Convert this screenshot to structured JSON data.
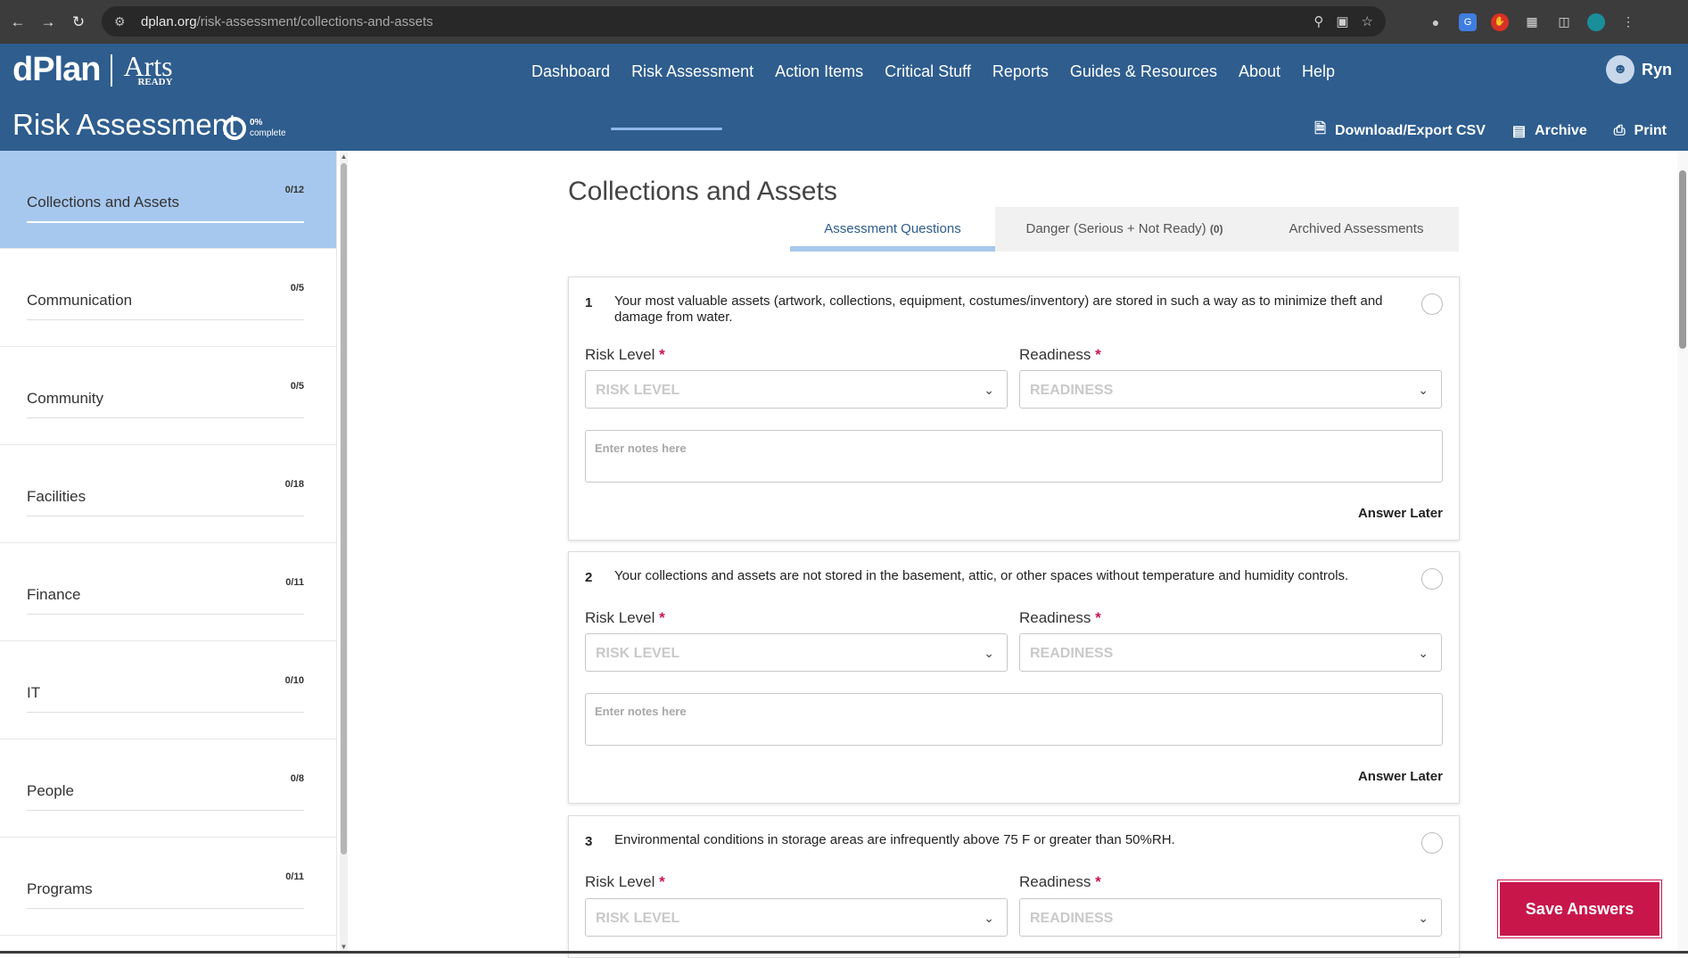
{
  "browser": {
    "url_host": "dplan.org",
    "url_path": "/risk-assessment/collections-and-assets"
  },
  "header": {
    "logo_main": "dPlan",
    "logo_arts": "Arts",
    "logo_ready": "READY",
    "nav": [
      "Dashboard",
      "Risk Assessment",
      "Action Items",
      "Critical Stuff",
      "Reports",
      "Guides & Resources",
      "About",
      "Help"
    ],
    "active_nav": "Risk Assessment",
    "user_name": "Ryn",
    "title": "Risk Assessment",
    "progress_pct": "0%",
    "progress_label": "complete",
    "actions": {
      "download": "Download/Export CSV",
      "archive": "Archive",
      "print": "Print"
    }
  },
  "sidebar": {
    "items": [
      {
        "label": "Collections and Assets",
        "count": "0/12",
        "active": true
      },
      {
        "label": "Communication",
        "count": "0/5"
      },
      {
        "label": "Community",
        "count": "0/5"
      },
      {
        "label": "Facilities",
        "count": "0/18"
      },
      {
        "label": "Finance",
        "count": "0/11"
      },
      {
        "label": "IT",
        "count": "0/10"
      },
      {
        "label": "People",
        "count": "0/8"
      },
      {
        "label": "Programs",
        "count": "0/11"
      }
    ]
  },
  "main": {
    "heading": "Collections and Assets",
    "tabs": {
      "questions": "Assessment Questions",
      "danger": "Danger (Serious + Not Ready)",
      "danger_count": "(0)",
      "archived": "Archived Assessments"
    },
    "risk_label": "Risk Level",
    "readiness_label": "Readiness",
    "risk_placeholder": "RISK LEVEL",
    "readiness_placeholder": "READINESS",
    "notes_placeholder": "Enter notes here",
    "answer_later": "Answer Later",
    "questions": [
      {
        "num": "1",
        "text": "Your most valuable assets (artwork, collections, equipment, costumes/inventory) are stored in such a way as to minimize theft and damage from water."
      },
      {
        "num": "2",
        "text": "Your collections and assets are not stored in the basement, attic, or other spaces without temperature and humidity controls."
      },
      {
        "num": "3",
        "text": "Environmental conditions in storage areas are infrequently above 75 F or greater than 50%RH."
      }
    ],
    "save_button": "Save Answers"
  },
  "colors": {
    "header_bg": "#2e5d8e",
    "sidebar_active": "#a7c8ee",
    "save_button": "#c8164b"
  }
}
